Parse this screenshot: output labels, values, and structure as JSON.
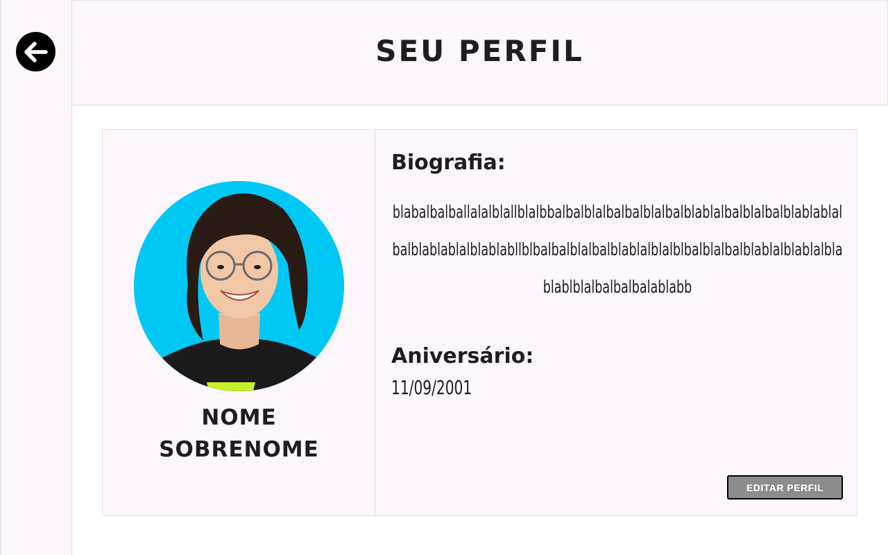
{
  "back_button": {
    "icon": "arrow-left-icon"
  },
  "header": {
    "title": "SEU PERFIL"
  },
  "profile": {
    "name_line1": "NOME",
    "name_line2": "SOBRENOME",
    "bio_label": "Biografia:",
    "bio_text": "blabalbalballalalblallblalbbalbalblalbalbalblalbalblablalbalblalbalblablablalbalblablablalblablabllblbalbalblalbalblablalblalblbalblalbalblablalblablalblablablblalbalbalbalablabb",
    "birthday_label": "Aniversário:",
    "birthday_value": "11/09/2001",
    "edit_button_label": "EDITAR PERFIL"
  },
  "colors": {
    "panel_background": "#fdf6fd",
    "avatar_background": "#00c8f4",
    "button_background": "#8c8c8c"
  }
}
